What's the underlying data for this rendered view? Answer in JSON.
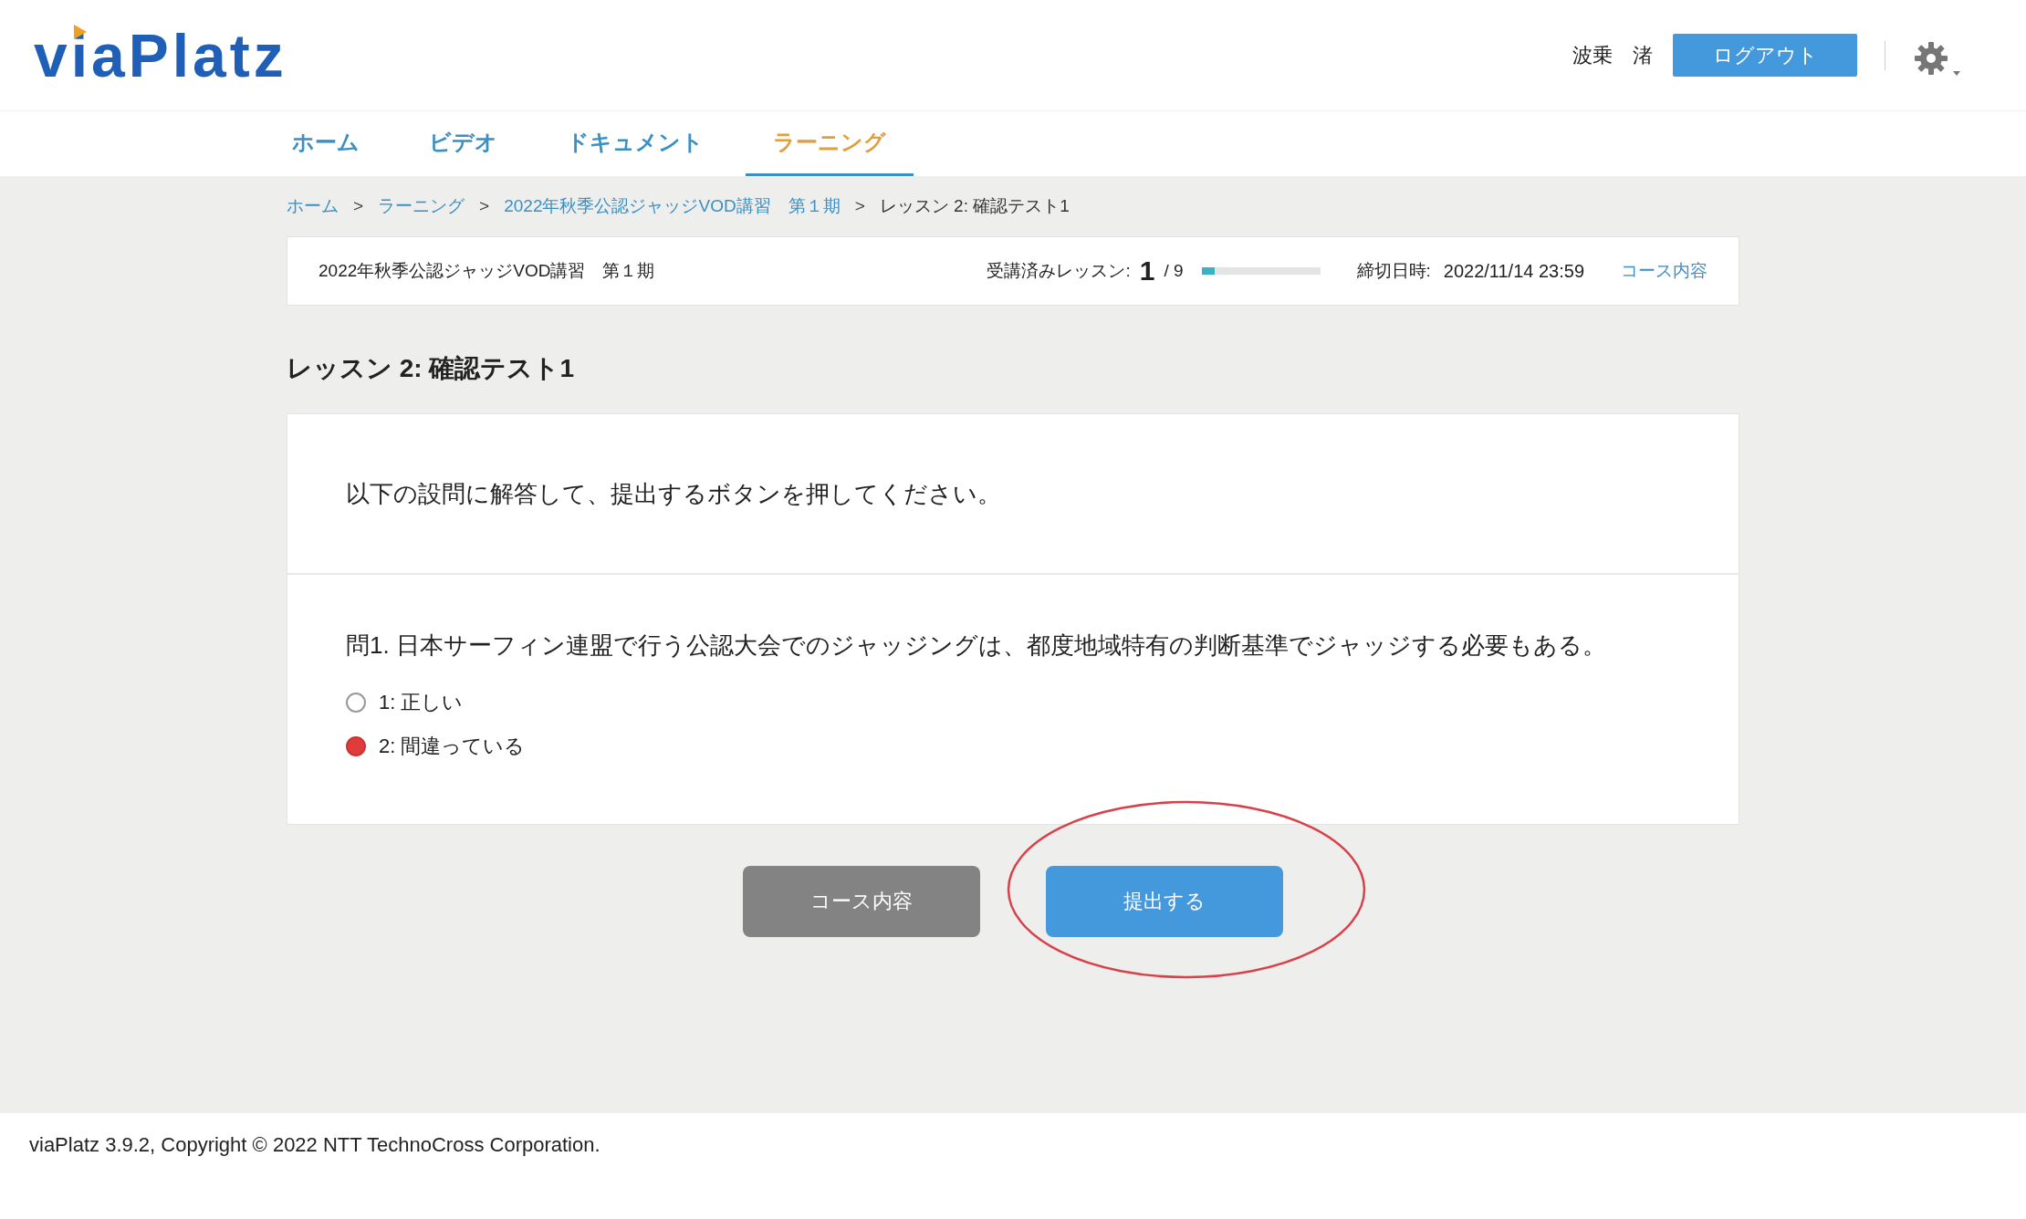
{
  "header": {
    "logo": "viaPlatz",
    "user_name": "波乗　渚",
    "logout_button": "ログアウト"
  },
  "nav_tabs": [
    {
      "label": "ホーム",
      "selected": false
    },
    {
      "label": "ビデオ",
      "selected": false
    },
    {
      "label": "ドキュメント",
      "selected": false
    },
    {
      "label": "ラーニング",
      "selected": true
    }
  ],
  "breadcrumb": [
    {
      "label": "ホーム",
      "link": true
    },
    {
      "label": "ラーニング",
      "link": true
    },
    {
      "label": "2022年秋季公認ジャッジVOD講習　第１期",
      "link": true
    },
    {
      "label": "レッスン 2: 確認テスト1",
      "link": false
    }
  ],
  "breadcrumb_separator": ">",
  "course_bar": {
    "course_name": "2022年秋季公認ジャッジVOD講習　第１期",
    "progress_label": "受講済みレッスン:",
    "completed": "1",
    "total": "/ 9",
    "level": 0.11,
    "deadline_label": "締切日時:",
    "deadline": "2022/11/14 23:59",
    "course_link": "コース内容"
  },
  "lesson_title": "レッスン 2: 確認テスト1",
  "instructions": "以下の設問に解答して、提出するボタンを押してください。",
  "question": {
    "text": "問1. 日本サーフィン連盟で行う公認大会でのジャッジングは、都度地域特有の判断基準でジャッジする必要もある。",
    "options": [
      {
        "label": "1: 正しい",
        "selected": false
      },
      {
        "label": "2: 間違っている",
        "selected": true
      }
    ]
  },
  "buttons": [
    {
      "label": "コース内容",
      "kind": "secondary"
    },
    {
      "label": "提出する",
      "kind": "primary",
      "circled": true
    }
  ],
  "footer": "viaPlatz 3.9.2, Copyright © 2022 NTT TechnoCross Corporation."
}
